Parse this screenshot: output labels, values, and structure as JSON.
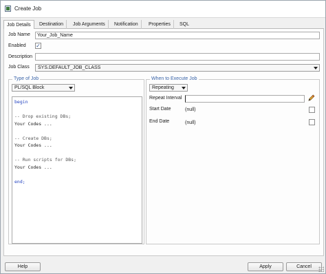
{
  "window": {
    "title": "Create Job"
  },
  "tabs": [
    {
      "label": "Job Details"
    },
    {
      "label": "Destination"
    },
    {
      "label": "Job Arguments"
    },
    {
      "label": "Notification"
    },
    {
      "label": "Properties"
    },
    {
      "label": "SQL"
    }
  ],
  "form": {
    "job_name_label": "Job Name",
    "job_name_value": "Your_Job_Name",
    "enabled_label": "Enabled",
    "enabled_checked": true,
    "description_label": "Description",
    "description_value": "",
    "job_class_label": "Job Class",
    "job_class_value": "SYS.DEFAULT_JOB_CLASS"
  },
  "type_of_job": {
    "group_title": "Type of Job",
    "selected": "PL/SQL Block",
    "code_lines": [
      {
        "text": "begin",
        "kind": "kw"
      },
      {
        "text": "",
        "kind": "txt"
      },
      {
        "text": "-- Drop existing DBs;",
        "kind": "cm"
      },
      {
        "text": "Your Codes ...",
        "kind": "txt"
      },
      {
        "text": "",
        "kind": "txt"
      },
      {
        "text": "-- Create DBs;",
        "kind": "cm"
      },
      {
        "text": "Your Codes ...",
        "kind": "txt"
      },
      {
        "text": "",
        "kind": "txt"
      },
      {
        "text": "-- Run scripts for DBs;",
        "kind": "cm"
      },
      {
        "text": "Your Codes ...",
        "kind": "txt"
      },
      {
        "text": "",
        "kind": "txt"
      },
      {
        "text": "end;",
        "kind": "kw"
      }
    ]
  },
  "when_to_execute": {
    "group_title": "When to Execute Job",
    "selected": "Repeating",
    "repeat_interval_label": "Repeat Interval",
    "repeat_interval_value": "",
    "start_date_label": "Start Date",
    "start_date_value": "(null)",
    "end_date_label": "End Date",
    "end_date_value": "(null)"
  },
  "footer": {
    "help_label": "Help",
    "apply_label": "Apply",
    "cancel_label": "Cancel"
  },
  "colors": {
    "group_title": "#3a64a8",
    "keyword": "#1f3fbf",
    "comment": "#555555"
  }
}
